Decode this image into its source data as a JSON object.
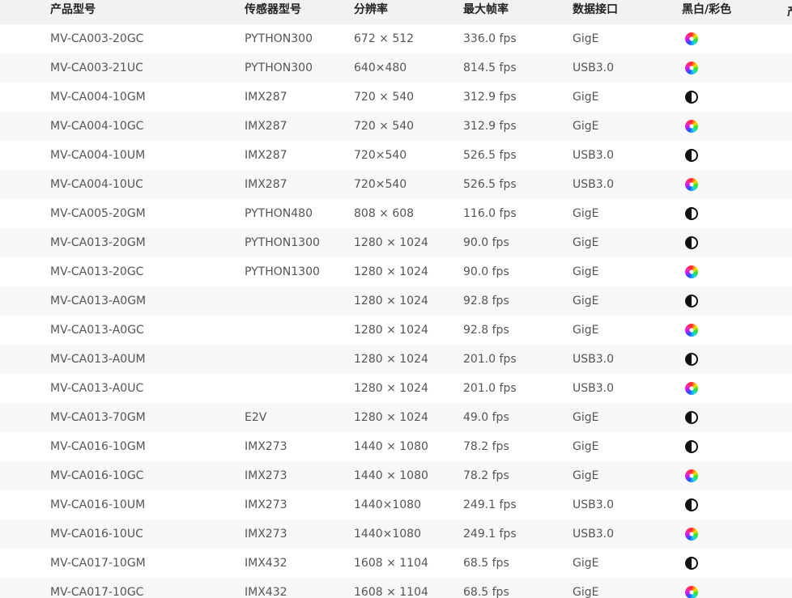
{
  "table": {
    "headers": [
      "产品型号",
      "传感器型号",
      "分辨率",
      "最大帧率",
      "数据接口",
      "黑白/彩色"
    ],
    "rows": [
      {
        "model": "MV-CA003-20GC",
        "sensor": "PYTHON300",
        "resolution": "672 × 512",
        "fps": "336.0 fps",
        "interface": "GigE",
        "color": "color-icon"
      },
      {
        "model": "MV-CA003-21UC",
        "sensor": "PYTHON300",
        "resolution": "640×480",
        "fps": "814.5 fps",
        "interface": "USB3.0",
        "color": "color-icon"
      },
      {
        "model": "MV-CA004-10GM",
        "sensor": "IMX287",
        "resolution": "720 × 540",
        "fps": "312.9 fps",
        "interface": "GigE",
        "color": "mono-icon"
      },
      {
        "model": "MV-CA004-10GC",
        "sensor": "IMX287",
        "resolution": "720 × 540",
        "fps": "312.9 fps",
        "interface": "GigE",
        "color": "color-icon"
      },
      {
        "model": "MV-CA004-10UM",
        "sensor": "IMX287",
        "resolution": "720×540",
        "fps": "526.5 fps",
        "interface": "USB3.0",
        "color": "mono-icon"
      },
      {
        "model": "MV-CA004-10UC",
        "sensor": "IMX287",
        "resolution": "720×540",
        "fps": "526.5 fps",
        "interface": "USB3.0",
        "color": "color-icon"
      },
      {
        "model": "MV-CA005-20GM",
        "sensor": "PYTHON480",
        "resolution": "808 × 608",
        "fps": "116.0 fps",
        "interface": "GigE",
        "color": "mono-icon"
      },
      {
        "model": "MV-CA013-20GM",
        "sensor": "PYTHON1300",
        "resolution": "1280 × 1024",
        "fps": "90.0 fps",
        "interface": "GigE",
        "color": "mono-icon"
      },
      {
        "model": "MV-CA013-20GC",
        "sensor": "PYTHON1300",
        "resolution": "1280 × 1024",
        "fps": "90.0 fps",
        "interface": "GigE",
        "color": "color-icon"
      },
      {
        "model": "MV-CA013-A0GM",
        "sensor": "",
        "resolution": "1280 × 1024",
        "fps": "92.8 fps",
        "interface": "GigE",
        "color": "mono-icon"
      },
      {
        "model": "MV-CA013-A0GC",
        "sensor": "",
        "resolution": "1280 × 1024",
        "fps": "92.8 fps",
        "interface": "GigE",
        "color": "color-icon"
      },
      {
        "model": "MV-CA013-A0UM",
        "sensor": "",
        "resolution": "1280 × 1024",
        "fps": "201.0 fps",
        "interface": "USB3.0",
        "color": "mono-icon"
      },
      {
        "model": "MV-CA013-A0UC",
        "sensor": "",
        "resolution": "1280 × 1024",
        "fps": "201.0 fps",
        "interface": "USB3.0",
        "color": "color-icon"
      },
      {
        "model": "MV-CA013-70GM",
        "sensor": "E2V",
        "resolution": "1280 × 1024",
        "fps": "49.0 fps",
        "interface": "GigE",
        "color": "mono-icon"
      },
      {
        "model": "MV-CA016-10GM",
        "sensor": "IMX273",
        "resolution": "1440 × 1080",
        "fps": "78.2 fps",
        "interface": "GigE",
        "color": "mono-icon"
      },
      {
        "model": "MV-CA016-10GC",
        "sensor": "IMX273",
        "resolution": "1440 × 1080",
        "fps": "78.2 fps",
        "interface": "GigE",
        "color": "color-icon"
      },
      {
        "model": "MV-CA016-10UM",
        "sensor": "IMX273",
        "resolution": "1440×1080",
        "fps": "249.1 fps",
        "interface": "USB3.0",
        "color": "mono-icon"
      },
      {
        "model": "MV-CA016-10UC",
        "sensor": "IMX273",
        "resolution": "1440×1080",
        "fps": "249.1 fps",
        "interface": "USB3.0",
        "color": "color-icon"
      },
      {
        "model": "MV-CA017-10GM",
        "sensor": "IMX432",
        "resolution": "1608 × 1104",
        "fps": "68.5 fps",
        "interface": "GigE",
        "color": "mono-icon"
      },
      {
        "model": "MV-CA017-10GC",
        "sensor": "IMX432",
        "resolution": "1608 × 1104",
        "fps": "68.5 fps",
        "interface": "GigE",
        "color": "color-icon"
      }
    ]
  }
}
